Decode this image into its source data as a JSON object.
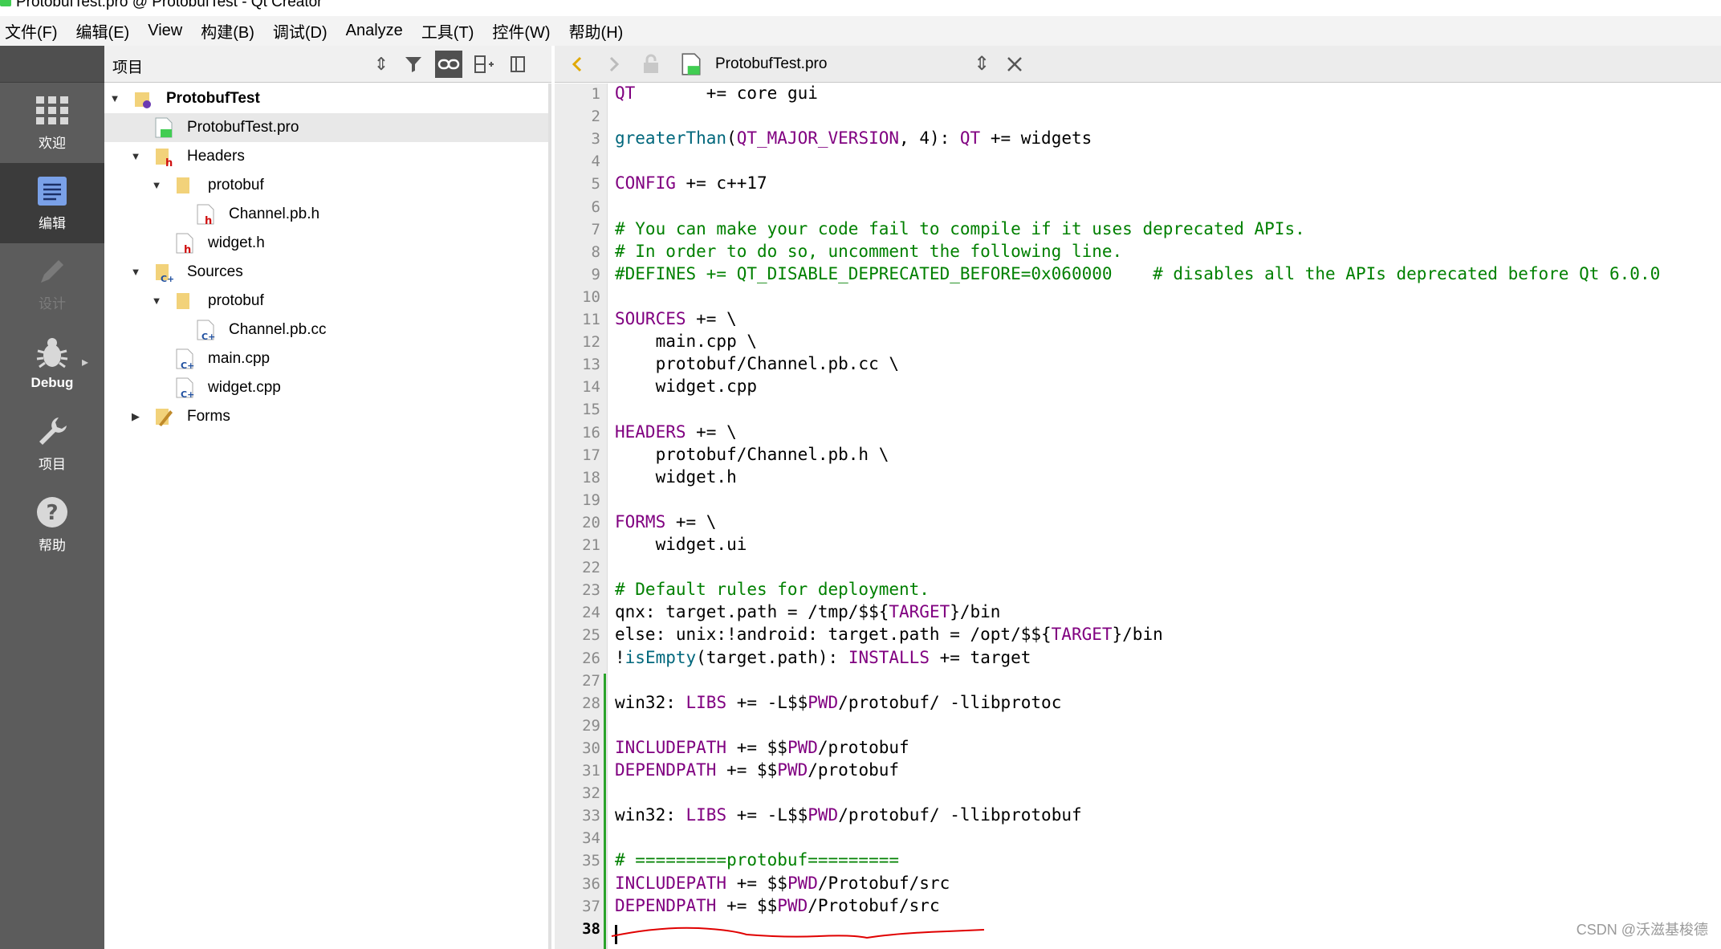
{
  "window": {
    "title": "ProtobufTest.pro @ ProtobufTest - Qt Creator"
  },
  "menu": [
    "文件(F)",
    "编辑(E)",
    "View",
    "构建(B)",
    "调试(D)",
    "Analyze",
    "工具(T)",
    "控件(W)",
    "帮助(H)"
  ],
  "modes": [
    {
      "label": "欢迎",
      "icon": "grid-icon",
      "active": false,
      "disabled": false
    },
    {
      "label": "编辑",
      "icon": "edit-document-icon",
      "active": true,
      "disabled": false
    },
    {
      "label": "设计",
      "icon": "pencil-icon",
      "active": false,
      "disabled": true
    },
    {
      "label": "Debug",
      "icon": "bug-icon",
      "active": false,
      "disabled": false
    },
    {
      "label": "项目",
      "icon": "wrench-icon",
      "active": false,
      "disabled": false
    },
    {
      "label": "帮助",
      "icon": "help-icon",
      "active": false,
      "disabled": false
    }
  ],
  "project_panel": {
    "title": "项目",
    "toolbar_icons": [
      "updown-icon",
      "filter-icon",
      "link-icon",
      "split-icon",
      "close-panel-icon"
    ]
  },
  "tree": [
    {
      "label": "ProtobufTest",
      "icon": "project-folder-icon",
      "expanded": true,
      "bold": true
    },
    {
      "label": "ProtobufTest.pro",
      "icon": "qt-pro-file-icon",
      "selected": true
    },
    {
      "label": "Headers",
      "icon": "headers-folder-icon",
      "expanded": true
    },
    {
      "label": "protobuf",
      "icon": "folder-icon",
      "expanded": true
    },
    {
      "label": "Channel.pb.h",
      "icon": "header-file-icon"
    },
    {
      "label": "widget.h",
      "icon": "header-file-icon"
    },
    {
      "label": "Sources",
      "icon": "sources-folder-icon",
      "expanded": true
    },
    {
      "label": "protobuf",
      "icon": "folder-icon",
      "expanded": true
    },
    {
      "label": "Channel.pb.cc",
      "icon": "cpp-file-icon"
    },
    {
      "label": "main.cpp",
      "icon": "cpp-file-icon"
    },
    {
      "label": "widget.cpp",
      "icon": "cpp-file-icon"
    },
    {
      "label": "Forms",
      "icon": "forms-folder-icon",
      "expanded": false
    }
  ],
  "editor": {
    "file": "ProtobufTest.pro",
    "toolbar_icons": [
      "back-icon",
      "forward-icon",
      "lock-icon",
      "qt-pro-file-icon",
      "updown-icon",
      "close-icon"
    ],
    "current_line": 38,
    "lines": [
      "QT       += core gui",
      "",
      "greaterThan(QT_MAJOR_VERSION, 4): QT += widgets",
      "",
      "CONFIG += c++17",
      "",
      "# You can make your code fail to compile if it uses deprecated APIs.",
      "# In order to do so, uncomment the following line.",
      "#DEFINES += QT_DISABLE_DEPRECATED_BEFORE=0x060000    # disables all the APIs deprecated before Qt 6.0.0",
      "",
      "SOURCES += \\",
      "    main.cpp \\",
      "    protobuf/Channel.pb.cc \\",
      "    widget.cpp",
      "",
      "HEADERS += \\",
      "    protobuf/Channel.pb.h \\",
      "    widget.h",
      "",
      "FORMS += \\",
      "    widget.ui",
      "",
      "# Default rules for deployment.",
      "qnx: target.path = /tmp/$${TARGET}/bin",
      "else: unix:!android: target.path = /opt/$${TARGET}/bin",
      "!isEmpty(target.path): INSTALLS += target",
      "",
      "win32: LIBS += -L$$PWD/protobuf/ -llibprotoc",
      "",
      "INCLUDEPATH += $$PWD/protobuf",
      "DEPENDPATH += $$PWD/protobuf",
      "",
      "win32: LIBS += -L$$PWD/protobuf/ -llibprotobuf",
      "",
      "# =========protobuf=========",
      "INCLUDEPATH += $$PWD/Protobuf/src",
      "DEPENDPATH += $$PWD/Protobuf/src",
      ""
    ]
  },
  "colors": {
    "keyword": "#800080",
    "function": "#00677c",
    "comment": "#008000",
    "annotation": "#e00000"
  },
  "watermark": "CSDN @沃滋基梭德"
}
